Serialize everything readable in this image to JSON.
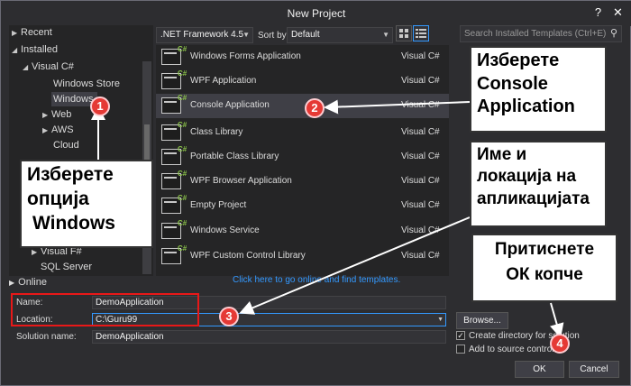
{
  "window": {
    "title": "New Project",
    "help_glyph": "?",
    "close_glyph": "✕"
  },
  "tree": {
    "recent": "Recent",
    "installed": "Installed",
    "visual_csharp": "Visual C#",
    "windows_store": "Windows Store",
    "windows": "Windows",
    "web": "Web",
    "aws": "AWS",
    "cloud": "Cloud",
    "visual_fsharp": "Visual F#",
    "sql_server": "SQL Server",
    "online": "Online"
  },
  "toolbar": {
    "framework": ".NET Framework 4.5",
    "sort_label": "Sort by:",
    "sort_value": "Default",
    "search_placeholder": "Search Installed Templates (Ctrl+E)"
  },
  "templates": [
    {
      "name": "Windows Forms Application",
      "lang": "Visual C#"
    },
    {
      "name": "WPF Application",
      "lang": "Visual C#"
    },
    {
      "name": "Console Application",
      "lang": "Visual C#"
    },
    {
      "name": "Class Library",
      "lang": "Visual C#"
    },
    {
      "name": "Portable Class Library",
      "lang": "Visual C#"
    },
    {
      "name": "WPF Browser Application",
      "lang": "Visual C#"
    },
    {
      "name": "Empty Project",
      "lang": "Visual C#"
    },
    {
      "name": "Windows Service",
      "lang": "Visual C#"
    },
    {
      "name": "WPF Custom Control Library",
      "lang": "Visual C#"
    }
  ],
  "template_badge": "C#",
  "online_link": "Click here to go online and find templates.",
  "form": {
    "name_label": "Name:",
    "name_value": "DemoApplication",
    "location_label": "Location:",
    "location_value": "C:\\Guru99",
    "solution_label": "Solution name:",
    "solution_value": "DemoApplication",
    "browse_label": "Browse...",
    "create_dir_label": "Create directory for solution",
    "source_control_label": "Add to source control",
    "ok_label": "OK",
    "cancel_label": "Cancel"
  },
  "callouts": {
    "c1_line1": "Изберете",
    "c1_line2": "опција",
    "c1_line3": "Windows",
    "c2_line1": "Изберете",
    "c2_line2": "Console",
    "c2_line3": "Application",
    "c3_line1": "Име и",
    "c3_line2": "локација на",
    "c3_line3": "апликацијата",
    "c4_line1": "Притиснете",
    "c4_line2": "ОК копче"
  },
  "badges": [
    "1",
    "2",
    "3",
    "4"
  ],
  "colors": {
    "window_bg": "#2d2d30",
    "pane_bg": "#252526",
    "accent": "#3399ff",
    "highlight_red": "#e81818",
    "badge_red": "#e53935"
  }
}
